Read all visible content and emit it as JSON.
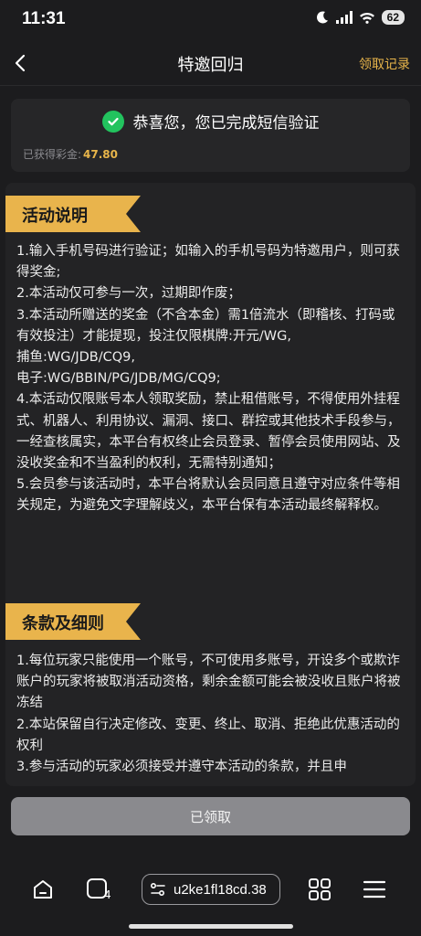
{
  "status_bar": {
    "time": "11:31",
    "battery": "62"
  },
  "nav": {
    "title": "特邀回归",
    "right_link": "领取记录"
  },
  "card": {
    "success_message": "恭喜您，您已完成短信验证",
    "earned_label": "已获得彩金:",
    "earned_amount": "47.80"
  },
  "sections": {
    "activity": {
      "title": "活动说明",
      "lines": [
        "1.输入手机号码进行验证；如输入的手机号码为特邀用户，则可获得奖金;",
        "2.本活动仅可参与一次，过期即作废；",
        "3.本活动所赠送的奖金（不含本金）需1倍流水（即稽核、打码或有效投注）才能提现，投注仅限棋牌:开元/WG,",
        "捕鱼:WG/JDB/CQ9,",
        "电子:WG/BBIN/PG/JDB/MG/CQ9;",
        "4.本活动仅限账号本人领取奖励，禁止租借账号，不得使用外挂程式、机器人、利用协议、漏洞、接口、群控或其他技术手段参与，一经查核属实，本平台有权终止会员登录、暂停会员使用网站、及没收奖金和不当盈利的权利，无需特别通知；",
        "5.会员参与该活动时，本平台将默认会员同意且遵守对应条件等相关规定，为避免文字理解歧义，本平台保有本活动最终解释权。"
      ]
    },
    "terms": {
      "title": "条款及细则",
      "lines": [
        "1.每位玩家只能使用一个账号，不可使用多账号，开设多个或欺诈账户的玩家将被取消活动资格，剩余金额可能会被没收且账户将被冻结",
        "2.本站保留自行决定修改、变更、终止、取消、拒绝此优惠活动的权利",
        "3.参与活动的玩家必须接受并遵守本活动的条款，并且申"
      ]
    }
  },
  "claim_button": {
    "label": "已领取"
  },
  "bottom_bar": {
    "tab_count": "4",
    "url": "u2ke1fl18cd.38"
  },
  "colors": {
    "accent": "#e8b54a",
    "success": "#22c35e",
    "tag": "#e9b44c"
  }
}
